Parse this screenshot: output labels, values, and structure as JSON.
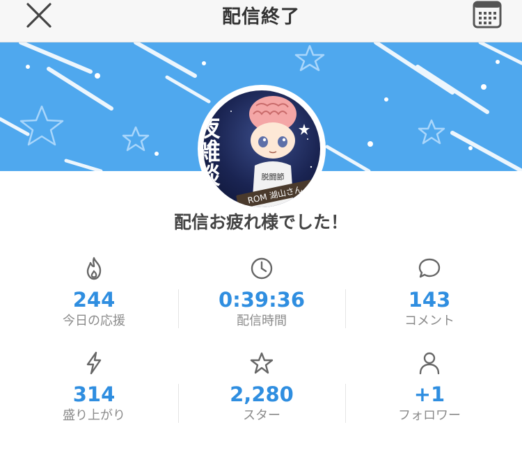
{
  "header": {
    "title": "配信終了",
    "close_icon": "close-icon",
    "calendar_icon": "calendar-icon"
  },
  "banner": {
    "background_color": "#4fa8ee",
    "avatar_text": "夜雑談",
    "avatar_shirt_text": "脱闘節",
    "avatar_sign_text": "ROM 湖山さん"
  },
  "message": "配信お疲れ様でした！",
  "stats": [
    {
      "icon": "flame-icon",
      "value": "244",
      "label": "今日の応援"
    },
    {
      "icon": "clock-icon",
      "value": "0:39:36",
      "label": "配信時間"
    },
    {
      "icon": "comment-icon",
      "value": "143",
      "label": "コメント"
    },
    {
      "icon": "lightning-icon",
      "value": "314",
      "label": "盛り上がり"
    },
    {
      "icon": "star-icon",
      "value": "2,280",
      "label": "スター"
    },
    {
      "icon": "person-icon",
      "value": "+1",
      "label": "フォロワー"
    }
  ],
  "colors": {
    "accent": "#2f8ee0",
    "label": "#8a8a8a",
    "icon": "#666666"
  }
}
